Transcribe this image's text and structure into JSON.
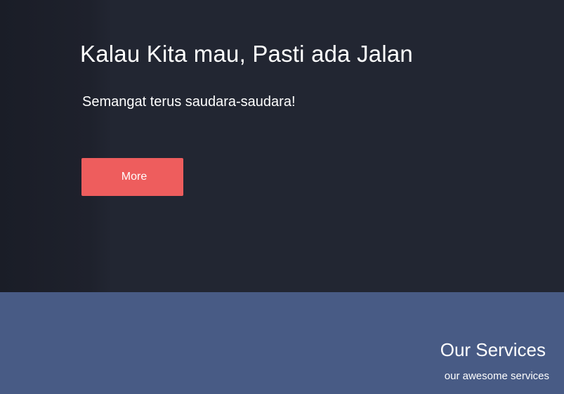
{
  "hero": {
    "title": "Kalau Kita mau, Pasti ada Jalan",
    "subtitle": "Semangat terus saudara-saudara!",
    "button_label": "More",
    "button_color": "#ee5d5d",
    "background_color": "#222632"
  },
  "services": {
    "title": "Our Services",
    "subtitle": "our awesome services",
    "background_color": "#485b85"
  }
}
